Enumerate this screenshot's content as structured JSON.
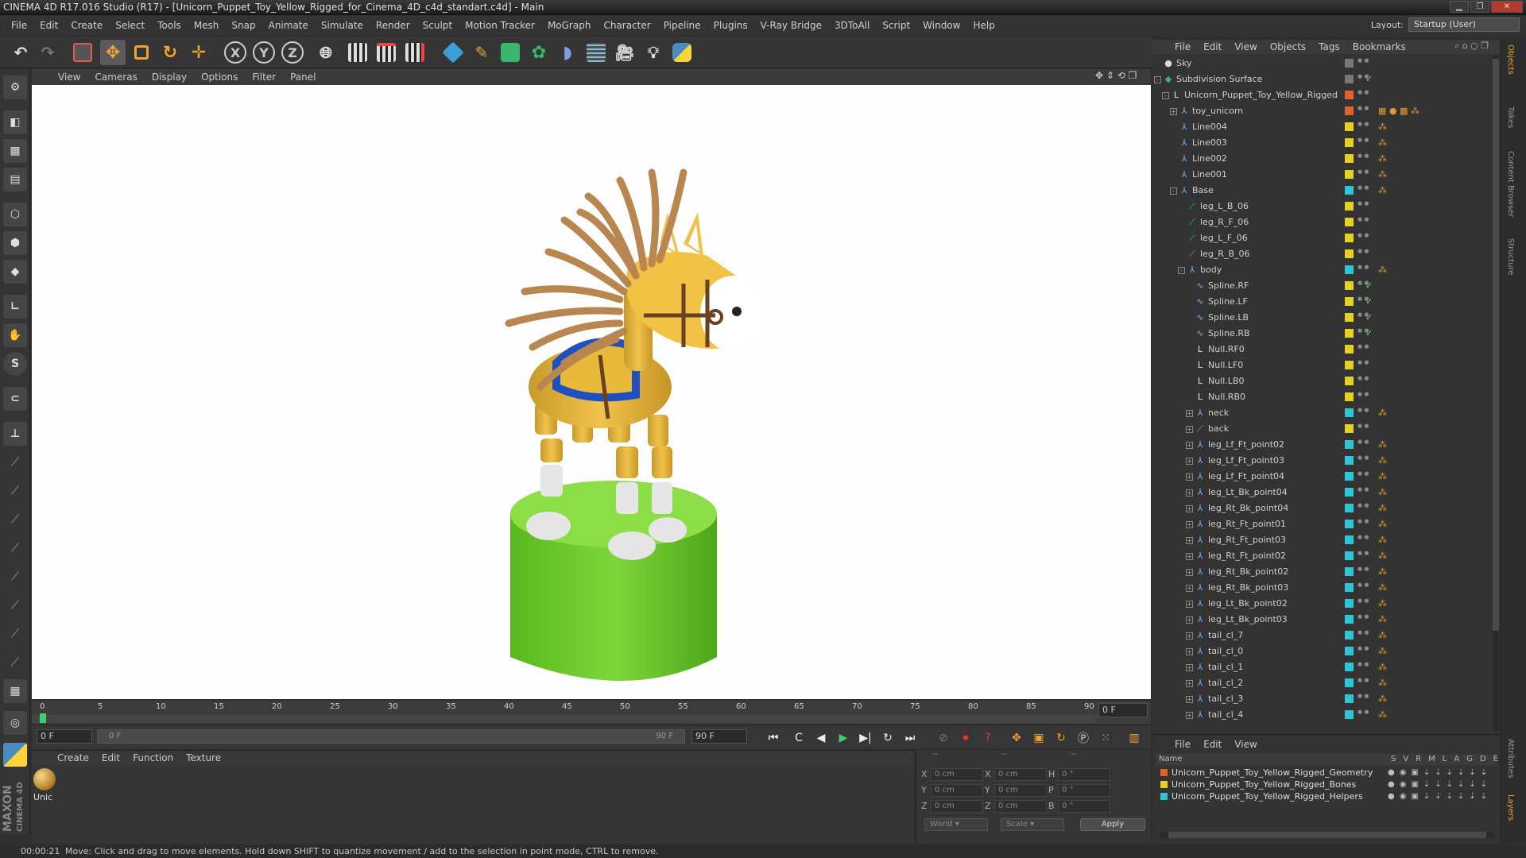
{
  "title": "CINEMA 4D R17.016 Studio (R17) - [Unicorn_Puppet_Toy_Yellow_Rigged_for_Cinema_4D_c4d_standart.c4d] - Main",
  "menu": [
    "File",
    "Edit",
    "Create",
    "Select",
    "Tools",
    "Mesh",
    "Snap",
    "Animate",
    "Simulate",
    "Render",
    "Sculpt",
    "Motion Tracker",
    "MoGraph",
    "Character",
    "Pipeline",
    "Plugins",
    "V-Ray Bridge",
    "3DToAll",
    "Script",
    "Window",
    "Help"
  ],
  "layout": {
    "label": "Layout:",
    "value": "Startup (User)"
  },
  "toolbar_axes": [
    "X",
    "Y",
    "Z"
  ],
  "viewport_menu": [
    "View",
    "Cameras",
    "Display",
    "Options",
    "Filter",
    "Panel"
  ],
  "timeline": {
    "ticks": [
      "0",
      "5",
      "10",
      "15",
      "20",
      "25",
      "30",
      "35",
      "40",
      "45",
      "50",
      "55",
      "60",
      "65",
      "70",
      "75",
      "80",
      "85",
      "90"
    ],
    "end_field": "0 F",
    "current": "0 F",
    "range_start": "0 F",
    "range_end": "90 F",
    "max": "90 F"
  },
  "material_menu": [
    "Create",
    "Edit",
    "Function",
    "Texture"
  ],
  "material": {
    "name": "Unic"
  },
  "coords": {
    "headers": [
      "--",
      "--",
      "--"
    ],
    "rows": [
      {
        "a": "X",
        "av": "0 cm",
        "b": "X",
        "bv": "0 cm",
        "c": "H",
        "cv": "0 °"
      },
      {
        "a": "Y",
        "av": "0 cm",
        "b": "Y",
        "bv": "0 cm",
        "c": "P",
        "cv": "0 °"
      },
      {
        "a": "Z",
        "av": "0 cm",
        "b": "Z",
        "bv": "0 cm",
        "c": "B",
        "cv": "0 °"
      }
    ],
    "world": "World",
    "scale": "Scale",
    "apply": "Apply"
  },
  "status": {
    "time": "00:00:21",
    "message": "Move: Click and drag to move elements. Hold down SHIFT to quantize movement / add to the selection in point mode, CTRL to remove."
  },
  "obj_menu": [
    "File",
    "Edit",
    "View",
    "Objects",
    "Tags",
    "Bookmarks"
  ],
  "objects": [
    {
      "name": "Sky",
      "indent": 0,
      "icon": "sky-icon",
      "color": "#777777",
      "tog": ""
    },
    {
      "name": "Subdivision Surface",
      "indent": 0,
      "icon": "subdivision-icon",
      "color": "#777777",
      "tog": "-",
      "check": "✓"
    },
    {
      "name": "Unicorn_Puppet_Toy_Yellow_Rigged",
      "indent": 1,
      "icon": "null-icon",
      "color": "#e0622a",
      "tog": "-"
    },
    {
      "name": "toy_unicorn",
      "indent": 2,
      "icon": "joint-icon",
      "color": "#e0622a",
      "tog": "+",
      "tags": "▦ ● ▩ ⁂"
    },
    {
      "name": "Line004",
      "indent": 2,
      "icon": "joint-icon",
      "color": "#e6d11e",
      "tog": "",
      "tags": "⁂"
    },
    {
      "name": "Line003",
      "indent": 2,
      "icon": "joint-icon",
      "color": "#e6d11e",
      "tog": "",
      "tags": "⁂"
    },
    {
      "name": "Line002",
      "indent": 2,
      "icon": "joint-icon",
      "color": "#e6d11e",
      "tog": "",
      "tags": "⁂"
    },
    {
      "name": "Line001",
      "indent": 2,
      "icon": "joint-icon",
      "color": "#e6d11e",
      "tog": "",
      "tags": "⁂"
    },
    {
      "name": "Base",
      "indent": 2,
      "icon": "joint-icon",
      "color": "#2ec7d6",
      "tog": "-",
      "tags": "⁂"
    },
    {
      "name": "leg_L_B_06",
      "indent": 3,
      "icon": "bone-icon",
      "color": "#e6d11e",
      "tog": ""
    },
    {
      "name": "leg_R_F_06",
      "indent": 3,
      "icon": "bone-icon",
      "color": "#e6d11e",
      "tog": ""
    },
    {
      "name": "leg_L_F_06",
      "indent": 3,
      "icon": "bone-icon",
      "color": "#e6d11e",
      "tog": ""
    },
    {
      "name": "leg_R_B_06",
      "indent": 3,
      "icon": "bone-icon",
      "color": "#e6d11e",
      "tog": ""
    },
    {
      "name": "body",
      "indent": 3,
      "icon": "joint-icon",
      "color": "#2ec7d6",
      "tog": "-",
      "tags": "⁂"
    },
    {
      "name": "Spline.RF",
      "indent": 4,
      "icon": "spline-icon",
      "color": "#e6d11e",
      "tog": "",
      "check": "✓"
    },
    {
      "name": "Spline.LF",
      "indent": 4,
      "icon": "spline-icon",
      "color": "#e6d11e",
      "tog": "",
      "check": "✓"
    },
    {
      "name": "Spline.LB",
      "indent": 4,
      "icon": "spline-icon",
      "color": "#e6d11e",
      "tog": "",
      "check": "✓"
    },
    {
      "name": "Spline.RB",
      "indent": 4,
      "icon": "spline-icon",
      "color": "#e6d11e",
      "tog": "",
      "check": "✓"
    },
    {
      "name": "Null.RF0",
      "indent": 4,
      "icon": "null-icon",
      "color": "#e6d11e",
      "tog": ""
    },
    {
      "name": "Null.LF0",
      "indent": 4,
      "icon": "null-icon",
      "color": "#e6d11e",
      "tog": ""
    },
    {
      "name": "Null.LB0",
      "indent": 4,
      "icon": "null-icon",
      "color": "#e6d11e",
      "tog": ""
    },
    {
      "name": "Null.RB0",
      "indent": 4,
      "icon": "null-icon",
      "color": "#e6d11e",
      "tog": ""
    },
    {
      "name": "neck",
      "indent": 4,
      "icon": "joint-icon",
      "color": "#2ec7d6",
      "tog": "+",
      "tags": "⁂"
    },
    {
      "name": "back",
      "indent": 4,
      "icon": "bone-icon",
      "color": "#e6d11e",
      "tog": "+"
    },
    {
      "name": "leg_Lf_Ft_point02",
      "indent": 4,
      "icon": "joint-icon",
      "color": "#2ec7d6",
      "tog": "+",
      "tags": "⁂"
    },
    {
      "name": "leg_Lf_Ft_point03",
      "indent": 4,
      "icon": "joint-icon",
      "color": "#2ec7d6",
      "tog": "+",
      "tags": "⁂"
    },
    {
      "name": "leg_Lf_Ft_point04",
      "indent": 4,
      "icon": "joint-icon",
      "color": "#2ec7d6",
      "tog": "+",
      "tags": "⁂"
    },
    {
      "name": "leg_Lt_Bk_point04",
      "indent": 4,
      "icon": "joint-icon",
      "color": "#2ec7d6",
      "tog": "+",
      "tags": "⁂"
    },
    {
      "name": "leg_Rt_Bk_point04",
      "indent": 4,
      "icon": "joint-icon",
      "color": "#2ec7d6",
      "tog": "+",
      "tags": "⁂"
    },
    {
      "name": "leg_Rt_Ft_point01",
      "indent": 4,
      "icon": "joint-icon",
      "color": "#2ec7d6",
      "tog": "+",
      "tags": "⁂"
    },
    {
      "name": "leg_Rt_Ft_point03",
      "indent": 4,
      "icon": "joint-icon",
      "color": "#2ec7d6",
      "tog": "+",
      "tags": "⁂"
    },
    {
      "name": "leg_Rt_Ft_point02",
      "indent": 4,
      "icon": "joint-icon",
      "color": "#2ec7d6",
      "tog": "+",
      "tags": "⁂"
    },
    {
      "name": "leg_Rt_Bk_point02",
      "indent": 4,
      "icon": "joint-icon",
      "color": "#2ec7d6",
      "tog": "+",
      "tags": "⁂"
    },
    {
      "name": "leg_Rt_Bk_point03",
      "indent": 4,
      "icon": "joint-icon",
      "color": "#2ec7d6",
      "tog": "+",
      "tags": "⁂"
    },
    {
      "name": "leg_Lt_Bk_point02",
      "indent": 4,
      "icon": "joint-icon",
      "color": "#2ec7d6",
      "tog": "+",
      "tags": "⁂"
    },
    {
      "name": "leg_Lt_Bk_point03",
      "indent": 4,
      "icon": "joint-icon",
      "color": "#2ec7d6",
      "tog": "+",
      "tags": "⁂"
    },
    {
      "name": "tail_cl_7",
      "indent": 4,
      "icon": "joint-icon",
      "color": "#2ec7d6",
      "tog": "+",
      "tags": "⁂"
    },
    {
      "name": "tail_cl_0",
      "indent": 4,
      "icon": "joint-icon",
      "color": "#2ec7d6",
      "tog": "+",
      "tags": "⁂"
    },
    {
      "name": "tail_cl_1",
      "indent": 4,
      "icon": "joint-icon",
      "color": "#2ec7d6",
      "tog": "+",
      "tags": "⁂"
    },
    {
      "name": "tail_cl_2",
      "indent": 4,
      "icon": "joint-icon",
      "color": "#2ec7d6",
      "tog": "+",
      "tags": "⁂"
    },
    {
      "name": "tail_cl_3",
      "indent": 4,
      "icon": "joint-icon",
      "color": "#2ec7d6",
      "tog": "+",
      "tags": "⁂"
    },
    {
      "name": "tail_cl_4",
      "indent": 4,
      "icon": "joint-icon",
      "color": "#2ec7d6",
      "tog": "+",
      "tags": "⁂"
    }
  ],
  "layer_menu": [
    "File",
    "Edit",
    "View"
  ],
  "layer_headers": {
    "name": "Name",
    "cols": [
      "S",
      "V",
      "R",
      "M",
      "L",
      "A",
      "G",
      "D",
      "E"
    ]
  },
  "layers": [
    {
      "name": "Unicorn_Puppet_Toy_Yellow_Rigged_Geometry",
      "color": "#e0622a"
    },
    {
      "name": "Unicorn_Puppet_Toy_Yellow_Rigged_Bones",
      "color": "#e6d11e"
    },
    {
      "name": "Unicorn_Puppet_Toy_Yellow_Rigged_Helpers",
      "color": "#2ec7d6"
    }
  ],
  "side_tabs": [
    "Objects",
    "Takes",
    "Content Browser",
    "Structure"
  ],
  "side_tabs_lower": [
    "Attributes",
    "Layers"
  ],
  "brand": {
    "maxon": "MAXON",
    "cinema": "CINEMA 4D"
  }
}
